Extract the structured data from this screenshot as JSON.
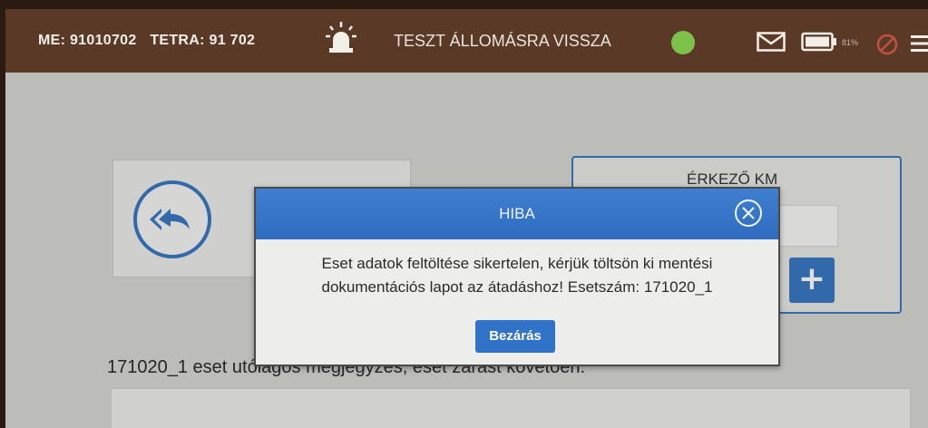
{
  "header": {
    "me_label": "ME: 91010702",
    "tetra_label": "TETRA: 91 702",
    "status_text": "TESZT ÁLLOMÁSRA VISSZA",
    "battery_percent": "81%",
    "status_color": "#7cc24a"
  },
  "km_panel": {
    "label": "ÉRKEZŐ KM",
    "value": "",
    "plus_label": "+"
  },
  "note": {
    "label": "171020_1 eset utólagos megjegyzés, eset zárást követően:",
    "value": ""
  },
  "dialog": {
    "title": "HIBA",
    "message_line1": "Eset adatok feltöltése sikertelen, kérjük töltsön ki mentési",
    "message_line2": "dokumentációs lapot az átadáshoz! Esetszám: 171020_1",
    "close_button": "Bezárás"
  },
  "icons": [
    "siren-icon",
    "mail-icon",
    "battery-icon",
    "block-icon",
    "menu-icon",
    "back-arrow-icon",
    "close-icon"
  ]
}
